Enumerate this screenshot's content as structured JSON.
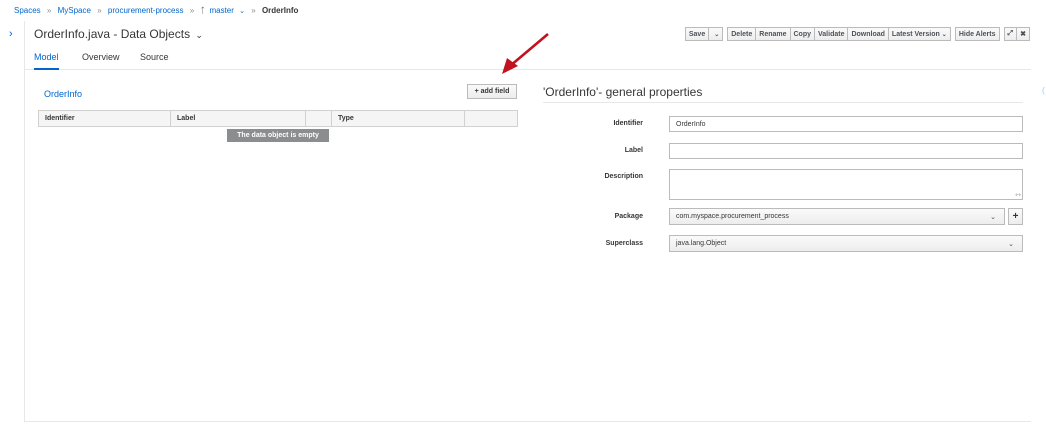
{
  "breadcrumb": {
    "items": [
      "Spaces",
      "MySpace",
      "procurement-process"
    ],
    "separator": "»",
    "branch": "master",
    "current": "OrderInfo"
  },
  "editor": {
    "title": "OrderInfo.java - Data Objects",
    "title_caret": "⌄"
  },
  "toolbar": {
    "save": "Save",
    "delete": "Delete",
    "rename": "Rename",
    "copy": "Copy",
    "validate": "Validate",
    "download": "Download",
    "latest_version": "Latest Version",
    "hide_alerts": "Hide Alerts",
    "expand_glyph": "⤢",
    "close_glyph": "✖"
  },
  "tabs": [
    "Model",
    "Overview",
    "Source"
  ],
  "data_object": {
    "name": "OrderInfo",
    "add_field": "+ add field",
    "columns": [
      "Identifier",
      "Label",
      "Type"
    ],
    "empty_message": "The data object is empty"
  },
  "properties": {
    "title": "'OrderInfo'- general properties",
    "identifier_label": "Identifier",
    "identifier_value": "OrderInfo",
    "label_label": "Label",
    "label_value": "",
    "description_label": "Description",
    "description_value": "",
    "package_label": "Package",
    "package_value": "com.myspace.procurement_process",
    "package_add": "+",
    "superclass_label": "Superclass",
    "superclass_value": "java.lang.Object"
  },
  "annotation": {
    "arrow_color": "#c1121f"
  },
  "colors": {
    "link": "#0066cc",
    "text": "#363636",
    "border": "#bbbbbb"
  }
}
